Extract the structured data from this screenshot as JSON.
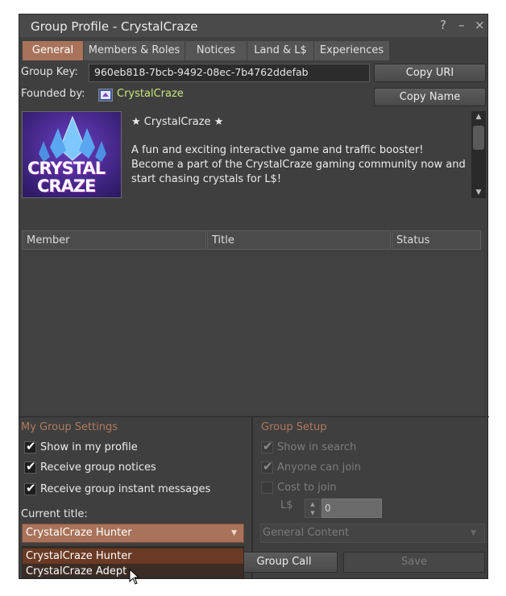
{
  "window": {
    "title": "Group Profile - CrystalCraze"
  },
  "titlebar_icons": {
    "help": "?",
    "minimize": "–",
    "close": "×"
  },
  "tabs": [
    {
      "label": "General",
      "active": true
    },
    {
      "label": "Members & Roles",
      "active": false
    },
    {
      "label": "Notices",
      "active": false
    },
    {
      "label": "Land & L$",
      "active": false
    },
    {
      "label": "Experiences",
      "active": false
    }
  ],
  "group_key": {
    "label": "Group Key:",
    "value": "960eb818-7bcb-9492-08ec-7b4762ddefab",
    "copy_label": "Copy URI"
  },
  "founded_by": {
    "label": "Founded by:",
    "name": "CrystalCraze",
    "copy_label": "Copy Name"
  },
  "insignia": {
    "line1": "CRYSTAL",
    "line2": "CRAZE"
  },
  "charter": {
    "line1": "★ CrystalCraze ★",
    "line2": "A fun and exciting interactive game and traffic booster!",
    "line3": "Become a part of the CrystalCraze gaming community now and",
    "line4": "start chasing crystals for L$!"
  },
  "members_table": {
    "columns": [
      "Member",
      "Title",
      "Status"
    ]
  },
  "my_settings": {
    "heading": "My Group Settings",
    "show_in_profile": "Show in my profile",
    "receive_notices": "Receive group notices",
    "receive_im": "Receive group instant messages",
    "current_title_label": "Current title:",
    "current_title": "CrystalCraze Hunter",
    "title_options": [
      "CrystalCraze Hunter",
      "CrystalCraze Adept"
    ]
  },
  "group_setup": {
    "heading": "Group Setup",
    "show_in_search": "Show in search",
    "anyone_can_join": "Anyone can join",
    "cost_to_join": "Cost to join",
    "currency": "L$",
    "cost_value": "0",
    "maturity": "General Content"
  },
  "buttons": {
    "group_call": "Group Call",
    "save": "Save"
  },
  "colors": {
    "accent": "#a8735a",
    "section_heading": "#b07a60",
    "founder_link": "#c8e87a"
  }
}
